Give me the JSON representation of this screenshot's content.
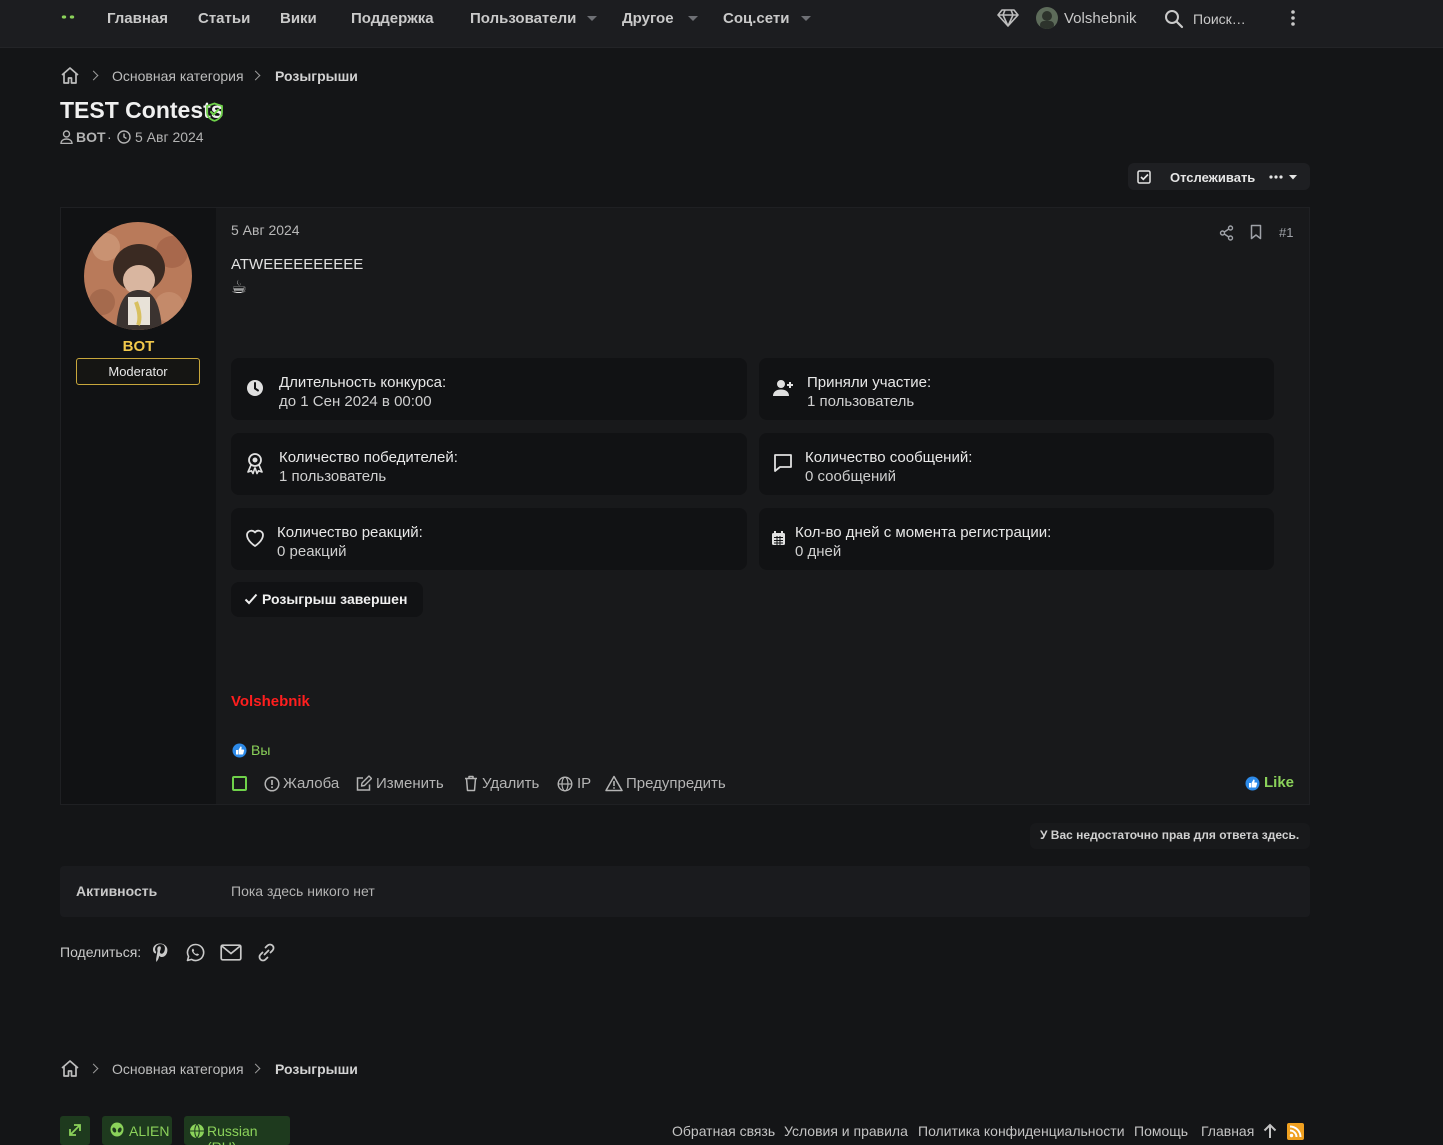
{
  "nav": {
    "items": [
      "Главная",
      "Статьи",
      "Вики",
      "Поддержка",
      "Пользователи",
      "Другое",
      "Соц.сети"
    ],
    "username": "Volshebnik",
    "search_placeholder": "Поиск…"
  },
  "breadcrumb": {
    "category": "Основная категория",
    "current": "Розыгрыши"
  },
  "thread": {
    "title": "TEST Contests",
    "author": "BOT",
    "date": "5 Авг 2024",
    "watch_label": "Отслеживать"
  },
  "post": {
    "user": {
      "name": "BOT",
      "role": "Moderator"
    },
    "date": "5 Авг 2024",
    "number": "#1",
    "text": "ATWEEEEEEEEEE",
    "emoji": "☕",
    "contest": {
      "duration_label": "Длительность конкурса:",
      "duration_value": "до 1 Сен 2024 в 00:00",
      "participants_label": "Приняли участие:",
      "participants_value": "1 пользователь",
      "winners_label": "Количество победителей:",
      "winners_value": "1 пользователь",
      "messages_label": "Количество сообщений:",
      "messages_value": "0 сообщений",
      "reactions_label": "Количество реакций:",
      "reactions_value": "0 реакций",
      "days_label": "Кол-во дней с момента регистрации:",
      "days_value": "0 дней",
      "status": "Розыгрыш завершен"
    },
    "signature": "Volshebnik",
    "reactions_by": "Вы",
    "actions": {
      "report": "Жалоба",
      "edit": "Изменить",
      "delete": "Удалить",
      "ip": "IP",
      "warn": "Предупредить",
      "like": "Like"
    }
  },
  "no_permission": "У Вас недостаточно прав для ответа здесь.",
  "activity": {
    "label": "Активность",
    "value": "Пока здесь никого нет"
  },
  "share_label": "Поделиться:",
  "footer": {
    "style": "ALIEN",
    "language": "Russian (RU)",
    "links": [
      "Обратная связь",
      "Условия и правила",
      "Политика конфиденциальности",
      "Помощь",
      "Главная"
    ]
  },
  "colors": {
    "background": "#141517",
    "accent_green": "#8bd25a",
    "username_gold": "#f2c94c",
    "signature_red": "#ff1e1e"
  }
}
